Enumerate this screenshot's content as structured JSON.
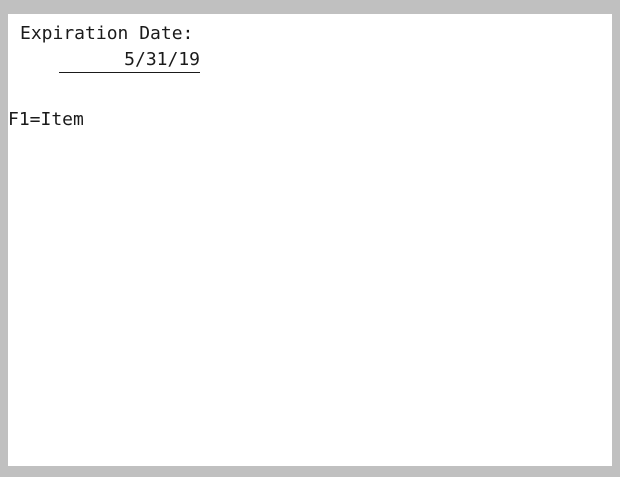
{
  "screen": {
    "prompt_label": "Expiration Date:",
    "expiration_date_value": "5/31/19",
    "function_key_hint": "F1=Item"
  }
}
